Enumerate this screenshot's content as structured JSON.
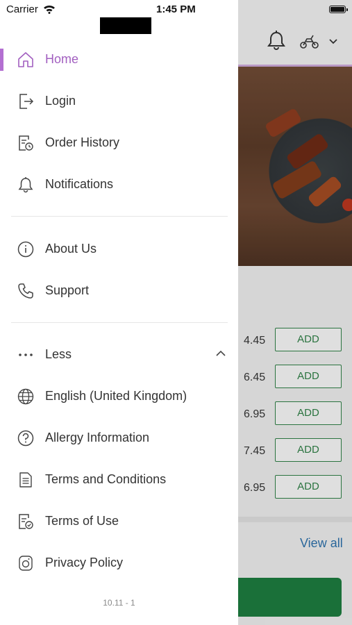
{
  "status_bar": {
    "carrier": "Carrier",
    "time": "1:45 PM"
  },
  "drawer": {
    "items_top": [
      {
        "label": "Home",
        "icon": "home-icon",
        "active": true
      },
      {
        "label": "Login",
        "icon": "login-icon"
      },
      {
        "label": "Order History",
        "icon": "order-history-icon"
      },
      {
        "label": "Notifications",
        "icon": "bell-icon"
      }
    ],
    "items_mid": [
      {
        "label": "About Us",
        "icon": "info-icon"
      },
      {
        "label": "Support",
        "icon": "phone-icon"
      }
    ],
    "less": {
      "label": "Less",
      "icon": "more-dots-icon"
    },
    "items_more": [
      {
        "label": "English (United Kingdom)",
        "icon": "globe-icon"
      },
      {
        "label": "Allergy Information",
        "icon": "question-icon"
      },
      {
        "label": "Terms and Conditions",
        "icon": "document-icon"
      },
      {
        "label": "Terms of Use",
        "icon": "document-check-icon"
      },
      {
        "label": "Privacy Policy",
        "icon": "privacy-icon"
      }
    ],
    "version": "10.11 - 1",
    "accent_color": "#a25fc0"
  },
  "background": {
    "products": [
      {
        "price": "4.45",
        "button": "ADD"
      },
      {
        "price": "6.45",
        "button": "ADD"
      },
      {
        "price": "6.95",
        "button": "ADD"
      },
      {
        "price": "7.45",
        "button": "ADD"
      },
      {
        "price": "6.95",
        "button": "ADD"
      }
    ],
    "view_all": "View all",
    "button_color": "#2e7d45"
  }
}
